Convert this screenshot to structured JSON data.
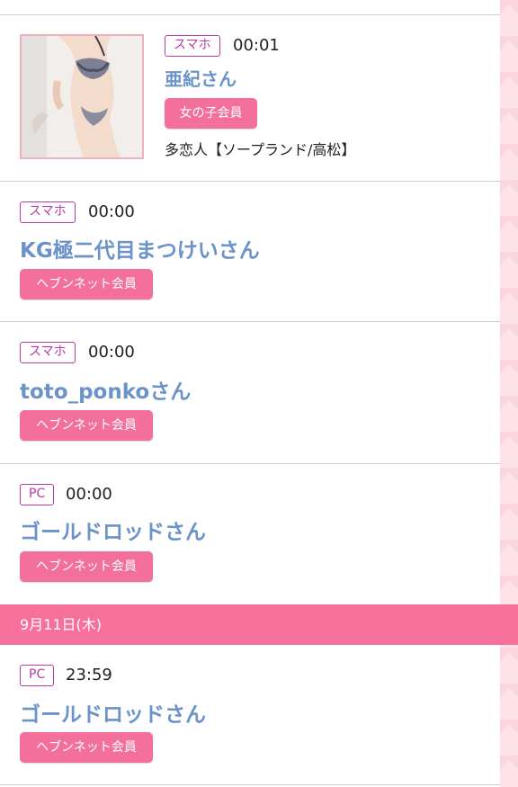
{
  "entries": [
    {
      "device": "スマホ",
      "time": "00:01",
      "name": "亜紀さん",
      "member_type": "女の子会員",
      "shop": "多恋人【ソープランド/高松】"
    },
    {
      "device": "スマホ",
      "time": "00:00",
      "name": "KG極二代目まつけいさん",
      "member_type": "ヘブンネット会員"
    },
    {
      "device": "スマホ",
      "time": "00:00",
      "name": "toto_ponkoさん",
      "member_type": "ヘブンネット会員"
    },
    {
      "device": "PC",
      "time": "00:00",
      "name": "ゴールドロッドさん",
      "member_type": "ヘブンネット会員"
    }
  ],
  "date_header": "9月11日(木)",
  "entries_after_date": [
    {
      "device": "PC",
      "time": "23:59",
      "name": "ゴールドロッドさん",
      "member_type": "ヘブンネット会員"
    }
  ],
  "colors": {
    "accent_pink": "#f2709b",
    "name_blue": "#6b93c9",
    "badge_purple": "#b83ba6"
  }
}
